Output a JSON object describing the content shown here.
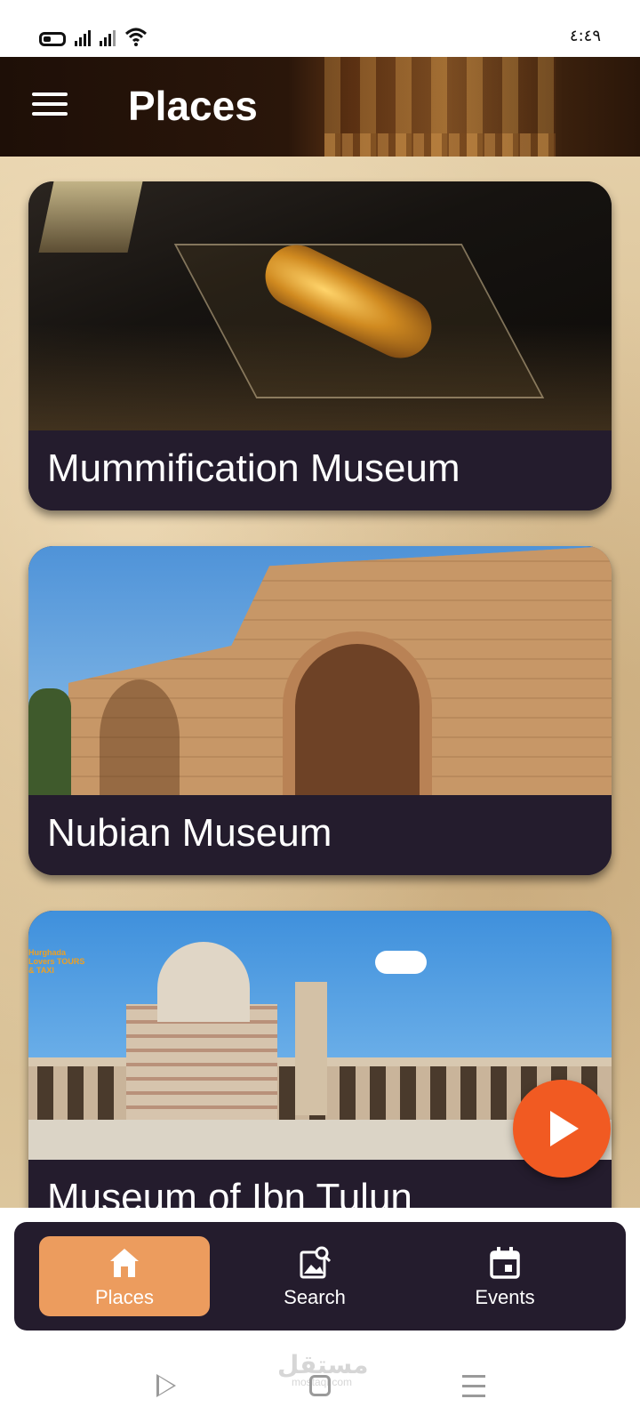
{
  "status_bar": {
    "time": "٤:٤٩",
    "icons": [
      "battery-icon",
      "signal-icon",
      "signal-icon",
      "wifi-icon"
    ]
  },
  "header": {
    "title": "Places",
    "menu_icon": "hamburger-icon"
  },
  "places": [
    {
      "title": "Mummification Museum"
    },
    {
      "title": "Nubian Museum"
    },
    {
      "title": "Museum of Ibn Tulun"
    }
  ],
  "image_overlays": {
    "logo_text": "Hurghada Lovers TOURS & TAXI"
  },
  "fab": {
    "icon": "play-icon",
    "color": "#f15a22"
  },
  "bottom_nav": {
    "items": [
      {
        "label": "Places",
        "icon": "home-icon",
        "active": true
      },
      {
        "label": "Search",
        "icon": "image-search-icon",
        "active": false
      },
      {
        "label": "Events",
        "icon": "calendar-icon",
        "active": false
      }
    ],
    "accent": "#ec9c5e",
    "background": "#241c2d"
  },
  "system_nav": {
    "watermark_ar": "مستقل",
    "watermark_en": "mostaql.com"
  }
}
